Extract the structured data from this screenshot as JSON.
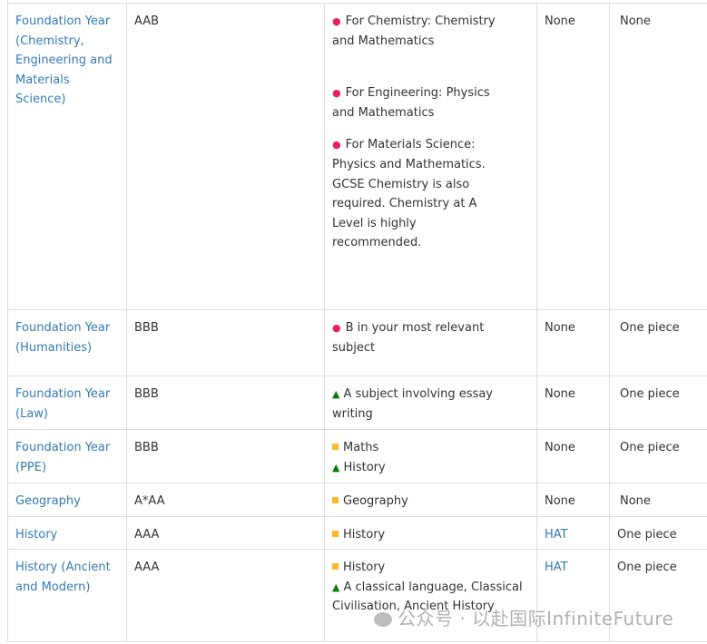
{
  "rows": [
    {
      "course": "Foundation Year (Chemistry, Engineering and Materials Science)",
      "grades": "AAB",
      "subjects": [
        {
          "marker": "pink-dot",
          "text": "For Chemistry: Chemistry and Mathematics"
        },
        {
          "marker": "pink-dot",
          "text": "For Engineering: Physics and Mathematics"
        },
        {
          "marker": "pink-dot",
          "text": "For Materials Science: Physics and Mathematics. GCSE Chemistry is also required. Chemistry at A Level is highly recommended."
        }
      ],
      "test": "None",
      "written_work": "None"
    },
    {
      "course": "Foundation Year (Humanities)",
      "grades": "BBB",
      "subjects": [
        {
          "marker": "pink-dot",
          "text": "B in your most relevant subject"
        }
      ],
      "test": "None",
      "written_work": "One piece"
    },
    {
      "course": "Foundation Year (Law)",
      "grades": "BBB",
      "subjects": [
        {
          "marker": "green-triangle",
          "text": "A subject involving essay writing"
        }
      ],
      "test": "None",
      "written_work": "One piece"
    },
    {
      "course": "Foundation Year (PPE)",
      "grades": "BBB",
      "subjects": [
        {
          "marker": "orange-square",
          "text": "Maths"
        },
        {
          "marker": "green-triangle",
          "text": "History"
        }
      ],
      "test": "None",
      "written_work": "One piece"
    },
    {
      "course": "Geography",
      "grades": "A*AA",
      "subjects": [
        {
          "marker": "orange-square",
          "text": "Geography"
        }
      ],
      "test": "None",
      "written_work": "None"
    },
    {
      "course": "History",
      "grades": "AAA",
      "subjects": [
        {
          "marker": "orange-square",
          "text": "History"
        }
      ],
      "test": "HAT",
      "written_work": "One piece"
    },
    {
      "course": "History (Ancient and Modern)",
      "grades": "AAA",
      "subjects": [
        {
          "marker": "orange-square",
          "text": "History"
        },
        {
          "marker": "green-triangle",
          "text": "A classical language, Classical Civilisation, Ancient History"
        }
      ],
      "test": "HAT",
      "written_work": "One piece"
    }
  ],
  "colors": {
    "link": "#337ab7",
    "pink-dot": "#e91e63",
    "green-triangle": "#0a7d0a",
    "orange-square": "#fbb829"
  },
  "watermark": "公众号 · 以赴国际InfiniteFuture"
}
